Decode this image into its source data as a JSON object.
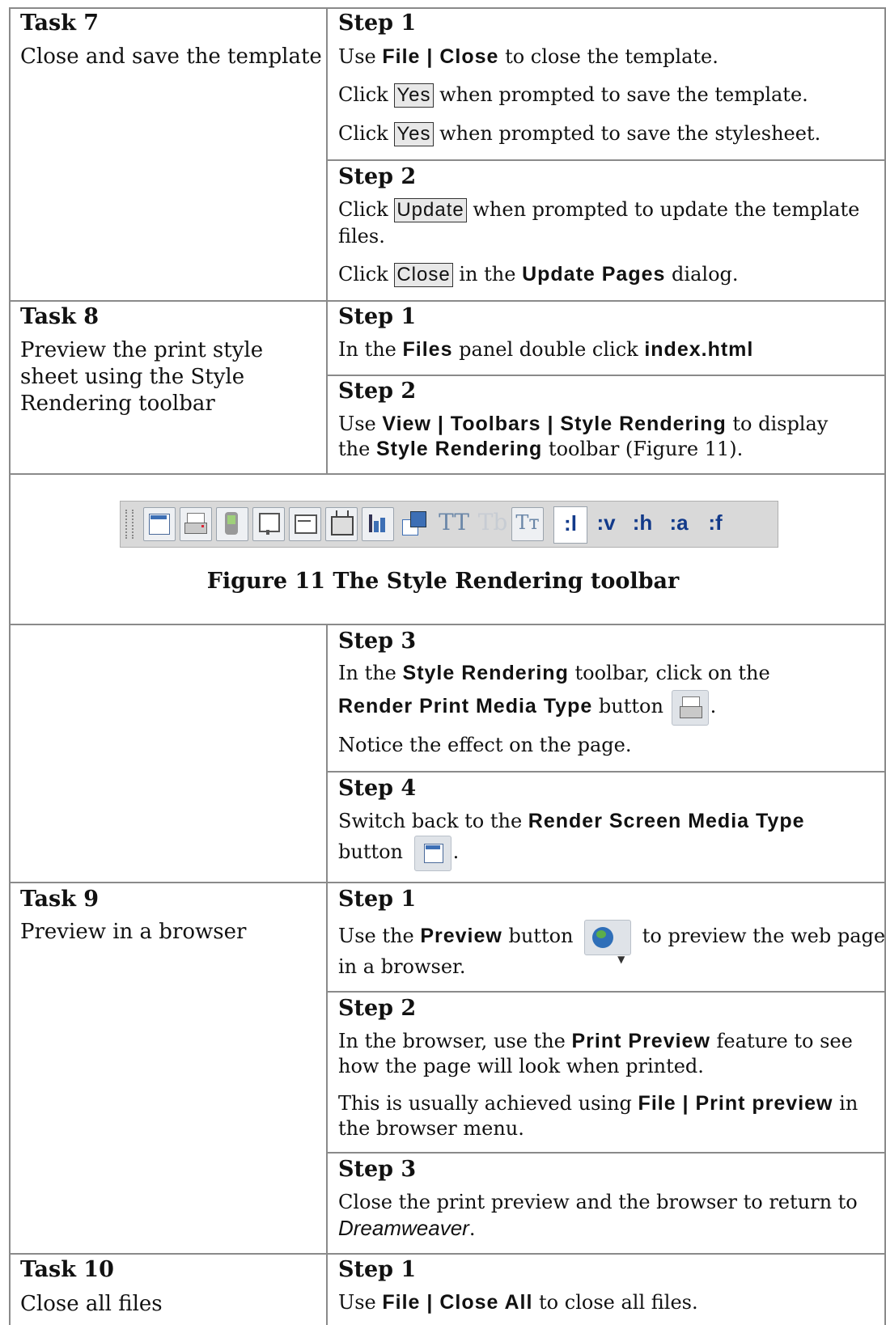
{
  "task7": {
    "title": "Task 7",
    "desc": "Close and save the template",
    "step1": {
      "title": "Step 1",
      "l1a": "Use",
      "l1ui": "File | Close",
      "l1b": "to close the template.",
      "l2a": "Click",
      "l2ui": "Yes",
      "l2b": "when prompted to save the template.",
      "l3a": "Click",
      "l3ui": "Yes",
      "l3b": "when prompted to save the stylesheet."
    },
    "step2": {
      "title": "Step 2",
      "l1a": "Click",
      "l1ui": "Update",
      "l1b": "when prompted to update the template",
      "l1c": "files.",
      "l2a": "Click",
      "l2ui": "Close",
      "l2b": "in the",
      "l2ui2": "Update Pages",
      "l2c": "dialog."
    }
  },
  "task8": {
    "title": "Task 8",
    "desc1": "Preview the print style",
    "desc2": "sheet using the Style",
    "desc3": "Rendering toolbar",
    "step1": {
      "title": "Step 1",
      "a": "In the",
      "ui1": "Files",
      "b": "panel double click",
      "ui2": "index.html"
    },
    "step2": {
      "title": "Step 2",
      "a": "Use",
      "ui1": "View | Toolbars | Style Rendering",
      "b": "to display",
      "c": "the",
      "ui2": "Style Rendering",
      "d": "toolbar (Figure 11)."
    },
    "figure_caption": "Figure 11 The Style Rendering toolbar",
    "toolbar_labels": [
      ":l",
      ":v",
      ":h",
      ":a",
      ":f"
    ],
    "step3": {
      "title": "Step 3",
      "a": "In the",
      "ui1": "Style Rendering",
      "b": "toolbar, click on the",
      "ui2": "Render Print Media Type",
      "c": "button",
      "d": ".",
      "e": "Notice the effect on the page."
    },
    "step4": {
      "title": "Step 4",
      "a": "Switch back to the",
      "ui1": "Render Screen Media Type",
      "b": "button",
      "c": "."
    }
  },
  "task9": {
    "title": "Task 9",
    "desc": "Preview in a browser",
    "step1": {
      "title": "Step 1",
      "a": "Use the",
      "ui1": "Preview",
      "b": "button",
      "c": "to preview the web page",
      "d": "in a browser."
    },
    "step2": {
      "title": "Step 2",
      "a": "In the browser, use the",
      "ui1": "Print Preview",
      "b": "feature to see",
      "c": "how the page will look when printed.",
      "d": "This is usually achieved using",
      "ui2": "File | Print preview",
      "e": "in",
      "f": "the browser menu."
    },
    "step3": {
      "title": "Step 3",
      "a": "Close the print preview and the browser to return to",
      "ital": "Dreamweaver",
      "b": "."
    }
  },
  "task10": {
    "title": "Task 10",
    "desc": "Close all files",
    "step1": {
      "title": "Step 1",
      "a": "Use",
      "ui1": "File | Close All",
      "b": "to close all files."
    }
  },
  "colors": {
    "grid": "#8a8a8a",
    "toolbar": "#d9d9d9",
    "label_blue": "#123a8a"
  }
}
